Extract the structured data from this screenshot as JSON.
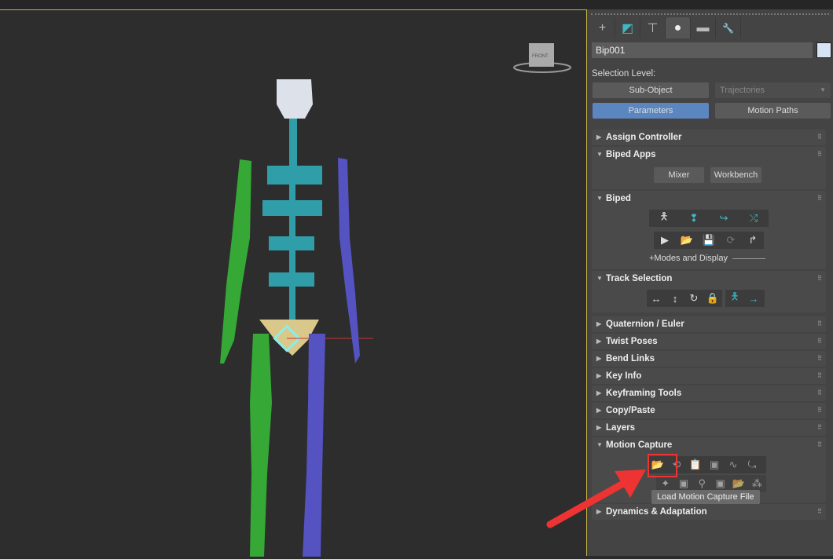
{
  "viewport": {
    "viewcube_label": "FRONT"
  },
  "panel": {
    "tabs": [
      {
        "name": "create",
        "glyph": "+"
      },
      {
        "name": "modify",
        "glyph": "◩"
      },
      {
        "name": "hierarchy",
        "glyph": "⊤"
      },
      {
        "name": "motion",
        "glyph": "●"
      },
      {
        "name": "display",
        "glyph": "▬"
      },
      {
        "name": "utilities",
        "glyph": "🔧"
      }
    ],
    "object_name": "Bip001",
    "selection_level_label": "Selection Level:",
    "sub_object": "Sub-Object",
    "trajectories": "Trajectories",
    "parameters": "Parameters",
    "motion_paths": "Motion Paths",
    "rollouts": {
      "assign_controller": "Assign Controller",
      "biped_apps": "Biped Apps",
      "mixer": "Mixer",
      "workbench": "Workbench",
      "biped": "Biped",
      "modes_display": "+Modes and Display",
      "track_selection": "Track Selection",
      "quaternion": "Quaternion / Euler",
      "twist": "Twist Poses",
      "bend": "Bend Links",
      "key_info": "Key Info",
      "keyframing": "Keyframing Tools",
      "copy_paste": "Copy/Paste",
      "layers": "Layers",
      "motion_capture": "Motion Capture",
      "dynamics": "Dynamics & Adaptation"
    },
    "tooltip": "Load Motion Capture File"
  },
  "colors": {
    "accent": "#5b86c0",
    "highlight": "#e33333"
  }
}
